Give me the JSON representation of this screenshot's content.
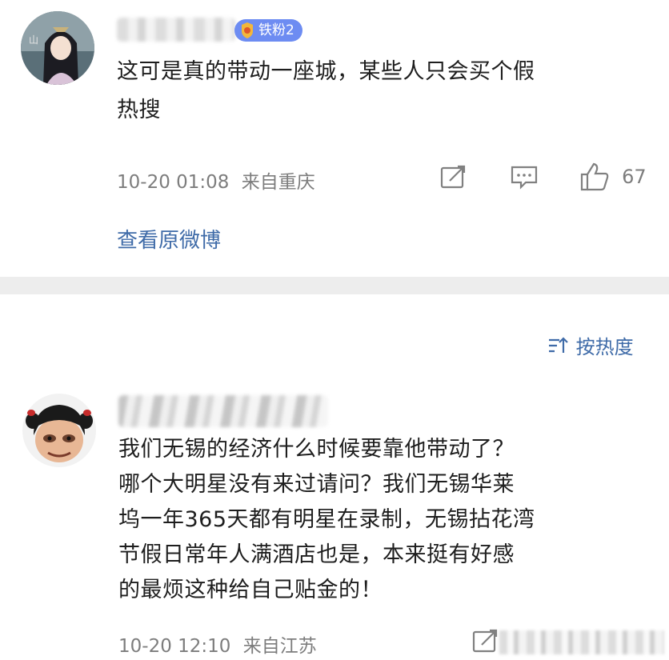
{
  "comment1": {
    "badge_label": "铁粉2",
    "text_line1": "这可是真的带动一座城，某些人只会买个假",
    "text_line2": "热搜",
    "timestamp": "10-20 01:08",
    "location": "来自重庆",
    "like_count": "67"
  },
  "view_original_label": "查看原微博",
  "sort_label": "按热度",
  "comment2": {
    "text_lines": [
      "我们无锡的经济什么时候要靠他带动了？",
      "哪个大明星没有来过请问？我们无锡华莱",
      "坞一年365天都有明星在录制，无锡拈花湾",
      "节假日常年人满酒店也是，本来挺有好感",
      "的最烦这种给自己贴金的！"
    ],
    "timestamp": "10-20 12:10",
    "location": "来自江苏"
  },
  "colors": {
    "link": "#3f6ba8",
    "badge": "#6d8cf2",
    "divider": "#ededed"
  },
  "icons": [
    "share-icon",
    "comment-icon",
    "like-icon",
    "sort-icon"
  ]
}
